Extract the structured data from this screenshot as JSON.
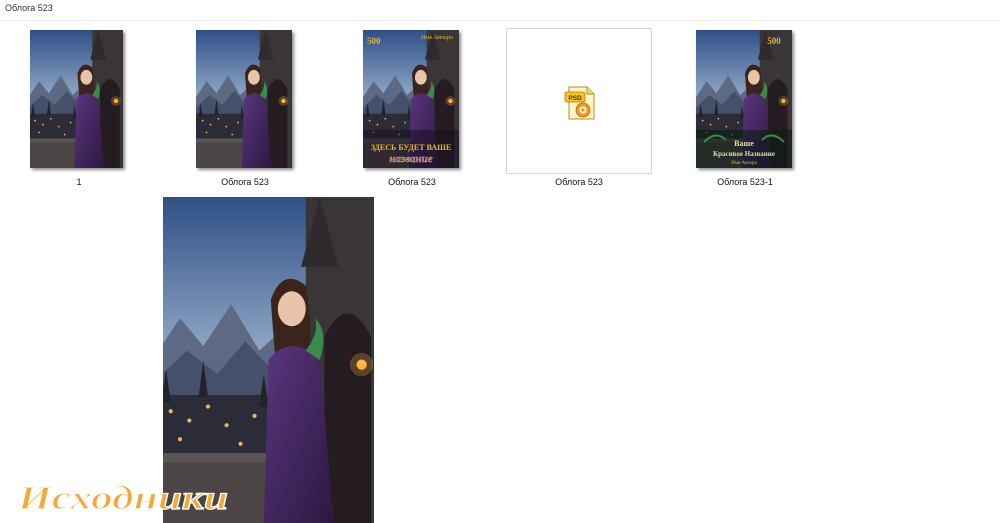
{
  "breadcrumb": "Облога 523",
  "files": [
    {
      "caption": "1",
      "kind": "image"
    },
    {
      "caption": "Облога  523",
      "kind": "image"
    },
    {
      "caption": "Облога 523",
      "kind": "cover"
    },
    {
      "caption": "Облога 523",
      "kind": "psd"
    },
    {
      "caption": "Облога 523-1",
      "kind": "cover"
    }
  ],
  "covers": {
    "cover_a": {
      "price": "500",
      "author": "Имя Автора",
      "title_line1": "ЗДЕСЬ БУДЕТ ВАШЕ",
      "title_line2": "название"
    },
    "cover_b": {
      "price": "500",
      "title_line1": "Ваше",
      "title_line2": "Красивое Название",
      "author": "Имя Автора"
    }
  },
  "psd_badge": "PSD",
  "watermark": "Исходники",
  "colors": {
    "gold": "#e2b43c",
    "watermark": "#f2a93b",
    "dress": "#4a2a66",
    "sky": "#3e5c8c"
  }
}
